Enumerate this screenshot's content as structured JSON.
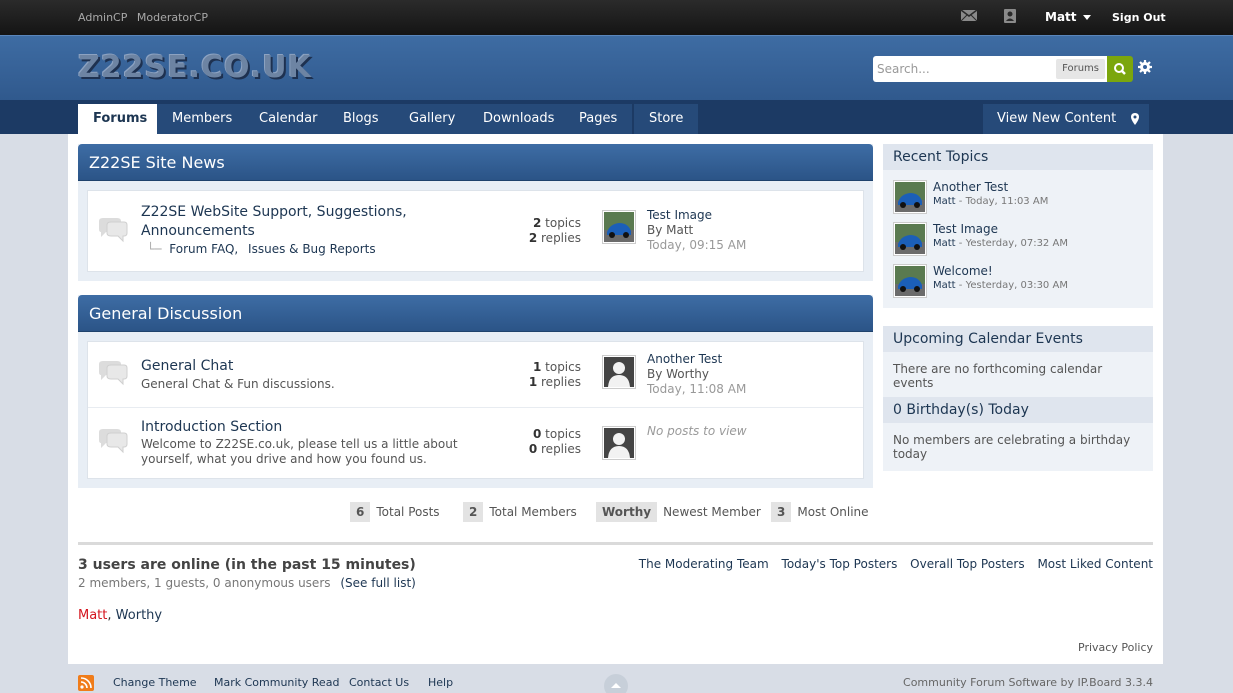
{
  "topbar": {
    "admin_link": "AdminCP",
    "mod_link": "ModeratorCP",
    "user": "Matt",
    "signout": "Sign Out"
  },
  "header": {
    "logo": "Z22SE.CO.UK",
    "search_placeholder": "Search...",
    "search_scope": "Forums"
  },
  "nav": {
    "tabs": [
      "Forums",
      "Members",
      "Calendar",
      "Blogs",
      "Gallery",
      "Downloads",
      "Pages",
      "Store"
    ],
    "view_new": "View New Content"
  },
  "categories": [
    {
      "title": "Z22SE Site News",
      "forums": [
        {
          "title": "Z22SE WebSite Support, Suggestions, Announcements",
          "title_line1": "Z22SE WebSite Support, Suggestions,",
          "title_line2": "Announcements",
          "subforums": [
            "Forum FAQ",
            "Issues & Bug Reports"
          ],
          "topics": "2",
          "topics_label": "topics",
          "replies": "2",
          "replies_label": "replies",
          "last_title": "Test Image",
          "last_by": "By Matt",
          "last_date": "Today, 09:15 AM"
        }
      ]
    },
    {
      "title": "General Discussion",
      "forums": [
        {
          "title": "General Chat",
          "desc": "General Chat & Fun discussions.",
          "topics": "1",
          "topics_label": "topics",
          "replies": "1",
          "replies_label": "replies",
          "last_title": "Another Test",
          "last_by": "By Worthy",
          "last_date": "Today, 11:08 AM"
        },
        {
          "title": "Introduction Section",
          "desc_line1": "Welcome to Z22SE.co.uk, please tell us a little about",
          "desc_line2": "yourself, what you drive and how you found us.",
          "topics": "0",
          "topics_label": "topics",
          "replies": "0",
          "replies_label": "replies",
          "no_posts": "No posts to view"
        }
      ]
    }
  ],
  "stats": {
    "total_posts_num": "6",
    "total_posts_label": "Total Posts",
    "total_members_num": "2",
    "total_members_label": "Total Members",
    "newest_member": "Worthy",
    "newest_label": "Newest Member",
    "most_online_num": "3",
    "most_online_label": "Most Online"
  },
  "online": {
    "heading": "3 users are online (in the past 15 minutes)",
    "sub": "2 members, 1 guests, 0 anonymous users",
    "full_list": "(See full list)",
    "links": [
      "The Moderating Team",
      "Today's Top Posters",
      "Overall Top Posters",
      "Most Liked Content"
    ],
    "user1": "Matt",
    "separator": ",",
    "user2": "Worthy",
    "user1_color": "#d4141e"
  },
  "privacy": "Privacy Policy",
  "sidebar": {
    "recent_title": "Recent Topics",
    "recent": [
      {
        "title": "Another Test",
        "author": "Matt",
        "date": " - Today, 11:03 AM"
      },
      {
        "title": "Test Image",
        "author": "Matt",
        "date": " - Yesterday, 07:32 AM"
      },
      {
        "title": "Welcome!",
        "author": "Matt",
        "date": " - Yesterday, 03:30 AM"
      }
    ],
    "calendar_title": "Upcoming Calendar Events",
    "calendar_text": "There are no forthcoming calendar events",
    "birthday_title": "0 Birthday(s) Today",
    "birthday_text": "No members are celebrating a birthday today"
  },
  "footer": {
    "change_theme": "Change Theme",
    "mark_read": "Mark Community Read",
    "contact": "Contact Us",
    "help": "Help",
    "copyright": "Community Forum Software by IP.Board 3.3.4"
  }
}
